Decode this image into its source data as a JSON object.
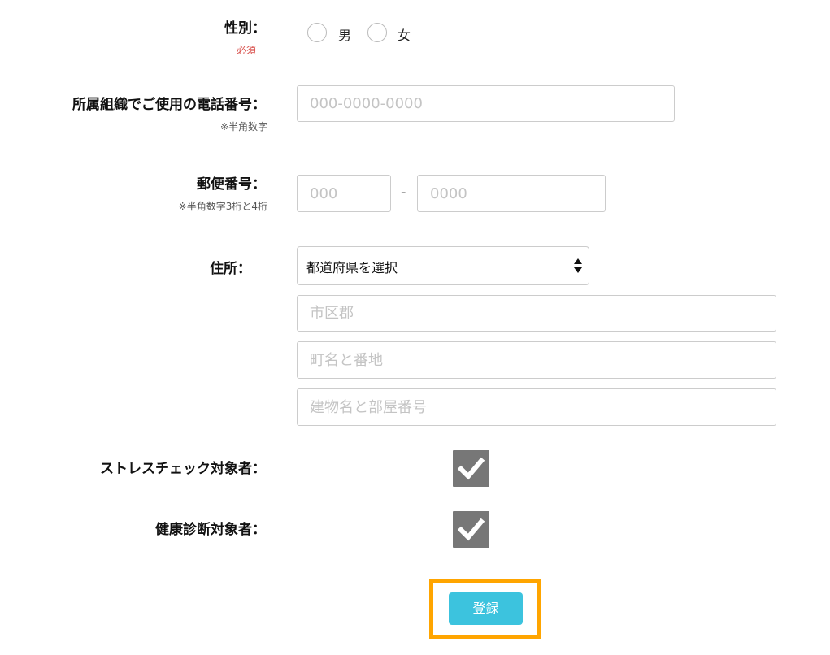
{
  "gender": {
    "label": "性別：",
    "required": "必須",
    "options": [
      {
        "label": "男",
        "selected": false
      },
      {
        "label": "女",
        "selected": false
      }
    ]
  },
  "phone": {
    "label": "所属組織でご使用の電話番号：",
    "note": "※半角数字",
    "placeholder": "000-0000-0000",
    "value": ""
  },
  "postal": {
    "label": "郵便番号：",
    "note": "※半角数字3桁と4桁",
    "placeholder1": "000",
    "separator": "-",
    "placeholder2": "0000"
  },
  "address": {
    "label": "住所：",
    "prefecture_select": "都道府県を選択",
    "city_placeholder": "市区郡",
    "town_placeholder": "町名と番地",
    "building_placeholder": "建物名と部屋番号"
  },
  "stress_check": {
    "label": "ストレスチェック対象者：",
    "checked": true
  },
  "health_check": {
    "label": "健康診断対象者：",
    "checked": true
  },
  "submit": {
    "label": "登録"
  },
  "colors": {
    "accent_button": "#3cc3de",
    "highlight_border": "#ffa500",
    "required_text": "#d9534f",
    "checkbox_fill": "#777777"
  }
}
